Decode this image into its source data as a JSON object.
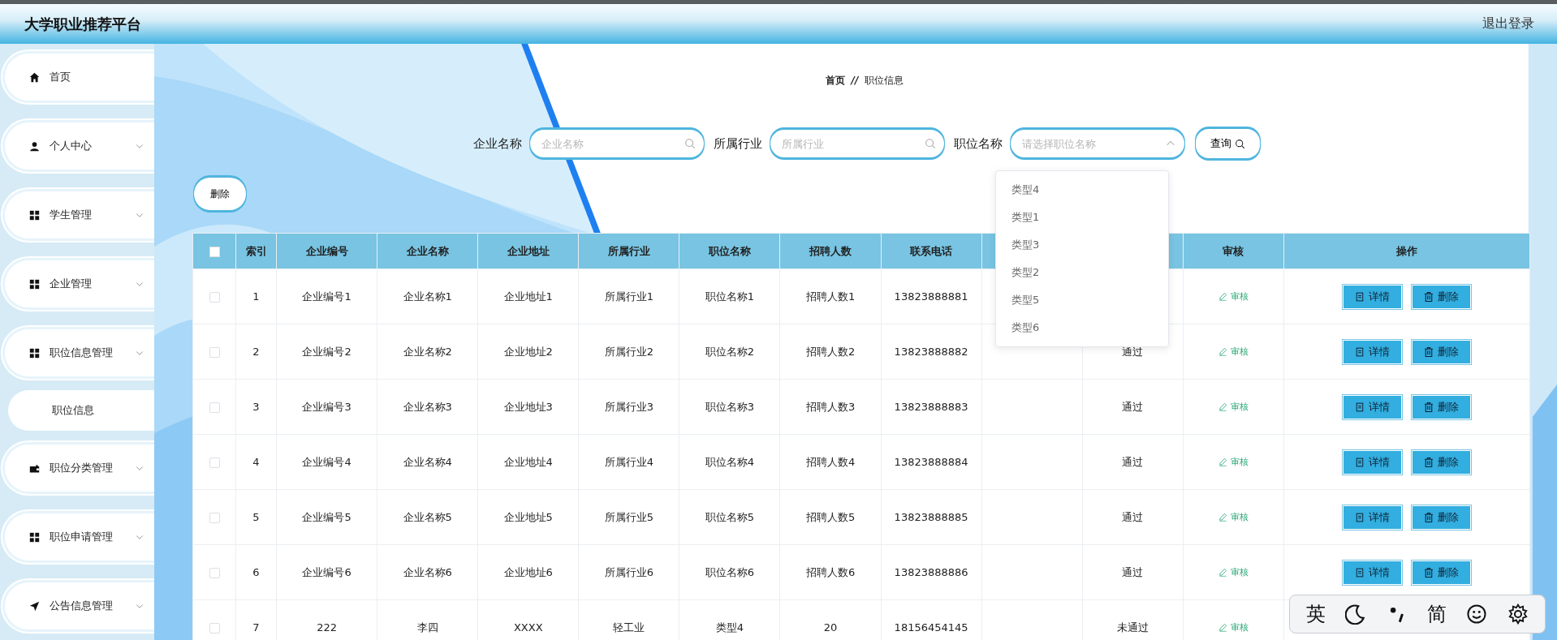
{
  "header": {
    "title": "大学职业推荐平台",
    "logout": "退出登录"
  },
  "sidebar": {
    "items": [
      {
        "label": "首页",
        "chevron": false
      },
      {
        "label": "个人中心",
        "chevron": true
      },
      {
        "label": "学生管理",
        "chevron": true
      },
      {
        "label": "企业管理",
        "chevron": true
      },
      {
        "label": "职位信息管理",
        "chevron": true,
        "children": [
          {
            "label": "职位信息"
          }
        ]
      },
      {
        "label": "职位分类管理",
        "chevron": true
      },
      {
        "label": "职位申请管理",
        "chevron": true
      },
      {
        "label": "公告信息管理",
        "chevron": true
      }
    ]
  },
  "breadcrumb": {
    "items": [
      "首页",
      "职位信息"
    ],
    "separator": "//"
  },
  "search": {
    "fields": [
      {
        "kind": "input",
        "label": "企业名称",
        "placeholder": "企业名称"
      },
      {
        "kind": "input",
        "label": "所属行业",
        "placeholder": "所属行业"
      },
      {
        "kind": "select",
        "label": "职位名称",
        "placeholder": "请选择职位名称",
        "open": true,
        "options": [
          "类型4",
          "类型1",
          "类型3",
          "类型2",
          "类型5",
          "类型6"
        ]
      }
    ],
    "button": "查询"
  },
  "delete_button": "删除",
  "table": {
    "all_checked": false,
    "columns": [
      "索引",
      "企业编号",
      "企业名称",
      "企业地址",
      "所属行业",
      "职位名称",
      "招聘人数",
      "联系电话",
      null,
      null,
      "审核",
      "操作"
    ],
    "rows": [
      {
        "checked": false,
        "cells": [
          "1",
          "企业编号1",
          "企业名称1",
          "企业地址1",
          "所属行业1",
          "职位名称1",
          "招聘人数1",
          "13823888881",
          null,
          null
        ],
        "review": "审核",
        "actions": [
          "详情",
          "删除"
        ]
      },
      {
        "checked": false,
        "cells": [
          "2",
          "企业编号2",
          "企业名称2",
          "企业地址2",
          "所属行业2",
          "职位名称2",
          "招聘人数2",
          "13823888882",
          null,
          "通过"
        ],
        "review": "审核",
        "actions": [
          "详情",
          "删除"
        ]
      },
      {
        "checked": false,
        "cells": [
          "3",
          "企业编号3",
          "企业名称3",
          "企业地址3",
          "所属行业3",
          "职位名称3",
          "招聘人数3",
          "13823888883",
          null,
          "通过"
        ],
        "review": "审核",
        "actions": [
          "详情",
          "删除"
        ]
      },
      {
        "checked": false,
        "cells": [
          "4",
          "企业编号4",
          "企业名称4",
          "企业地址4",
          "所属行业4",
          "职位名称4",
          "招聘人数4",
          "13823888884",
          null,
          "通过"
        ],
        "review": "审核",
        "actions": [
          "详情",
          "删除"
        ]
      },
      {
        "checked": false,
        "cells": [
          "5",
          "企业编号5",
          "企业名称5",
          "企业地址5",
          "所属行业5",
          "职位名称5",
          "招聘人数5",
          "13823888885",
          null,
          "通过"
        ],
        "review": "审核",
        "actions": [
          "详情",
          "删除"
        ]
      },
      {
        "checked": false,
        "cells": [
          "6",
          "企业编号6",
          "企业名称6",
          "企业地址6",
          "所属行业6",
          "职位名称6",
          "招聘人数6",
          "13823888886",
          null,
          "通过"
        ],
        "review": "审核",
        "actions": [
          "详情",
          "删除"
        ]
      },
      {
        "checked": false,
        "cells": [
          "7",
          "222",
          "李四",
          "XXXX",
          "轻工业",
          "类型4",
          "20",
          "18156454145",
          null,
          "未通过"
        ],
        "review": "审核"
      }
    ]
  },
  "ime_toolbar": {
    "language": "英",
    "script": "简"
  }
}
